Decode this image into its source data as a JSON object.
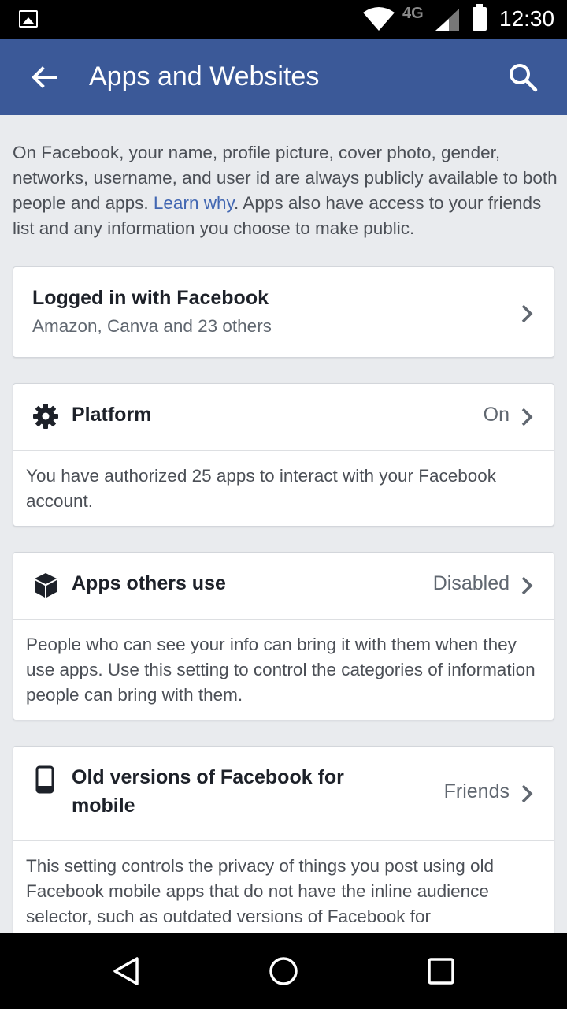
{
  "status_bar": {
    "network": "4G",
    "time": "12:30"
  },
  "app_bar": {
    "title": "Apps and Websites"
  },
  "intro": {
    "text_before": "On Facebook, your name, profile picture, cover photo, gender, networks, username, and user id are always publicly available to both people and apps. ",
    "link": "Learn why",
    "text_after": ". Apps also have access to your friends list and any information you choose to make public."
  },
  "cards": {
    "logged_in": {
      "title": "Logged in with Facebook",
      "subtitle": "Amazon, Canva and 23 others"
    },
    "platform": {
      "title": "Platform",
      "value": "On",
      "description": "You have authorized 25 apps to interact with your Facebook account."
    },
    "apps_others_use": {
      "title": "Apps others use",
      "value": "Disabled",
      "description": "People who can see your info can bring it with them when they use apps. Use this setting to control the categories of information people can bring with them."
    },
    "old_versions": {
      "title_line1": "Old versions of Facebook for",
      "title_line2": "mobile",
      "value": "Friends",
      "description": "This setting controls the privacy of things you post using old Facebook mobile apps that do not have the inline audience selector, such as outdated versions of Facebook for"
    }
  },
  "icons": {
    "back": "arrow-left-icon",
    "search": "search-icon",
    "platform": "gear-icon",
    "apps_others_use": "cube-icon",
    "old_versions": "phone-icon",
    "chevron": "chevron-right-icon"
  },
  "colors": {
    "brand": "#3b5998",
    "link": "#4267b2",
    "background": "#e9ebee"
  }
}
